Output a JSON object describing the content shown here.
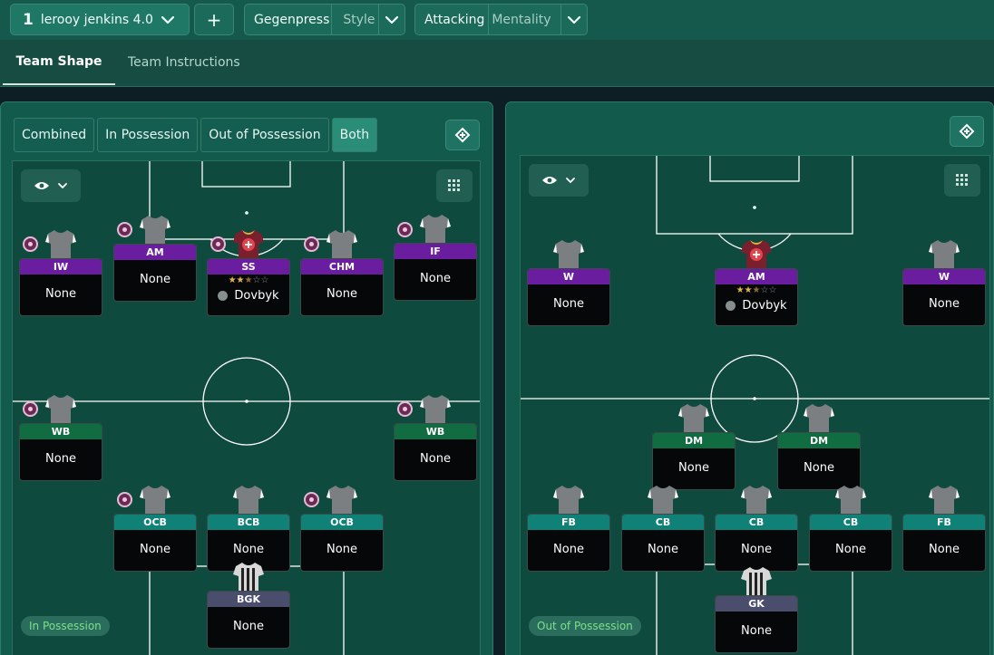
{
  "topbar": {
    "tactic_number": "1",
    "tactic_name": "lerooy jenkins 4.0",
    "add_label": "+",
    "style_value": "Gegenpress",
    "style_label": "Style",
    "mentality_value": "Attacking",
    "mentality_label": "Mentality"
  },
  "tabs": [
    {
      "label": "Team Shape",
      "active": true
    },
    {
      "label": "Team Instructions",
      "active": false
    }
  ],
  "view_modes": [
    "Combined",
    "In Possession",
    "Out of Possession",
    "Both"
  ],
  "active_view_mode": "Both",
  "colors": {
    "attack_role": "#6a1d9e",
    "midfield_role": "#126c42",
    "defence_role": "#0f8177",
    "goalkeeper_role": "#4a4d6c",
    "pill_text": "#7de08a"
  },
  "in_possession": {
    "label": "In Possession",
    "players": [
      {
        "role": "IW",
        "name": "None"
      },
      {
        "role": "AM",
        "name": "None"
      },
      {
        "role": "SS",
        "name": "Dovbyk",
        "stars": 2.5
      },
      {
        "role": "CHM",
        "name": "None"
      },
      {
        "role": "IF",
        "name": "None"
      },
      {
        "role": "WB",
        "name": "None"
      },
      {
        "role": "WB",
        "name": "None"
      },
      {
        "role": "OCB",
        "name": "None"
      },
      {
        "role": "BCB",
        "name": "None"
      },
      {
        "role": "OCB",
        "name": "None"
      },
      {
        "role": "BGK",
        "name": "None"
      }
    ]
  },
  "out_of_possession": {
    "label": "Out of Possession",
    "players": [
      {
        "role": "W",
        "name": "None"
      },
      {
        "role": "AM",
        "name": "Dovbyk",
        "stars": 2.5
      },
      {
        "role": "W",
        "name": "None"
      },
      {
        "role": "DM",
        "name": "None"
      },
      {
        "role": "DM",
        "name": "None"
      },
      {
        "role": "FB",
        "name": "None"
      },
      {
        "role": "CB",
        "name": "None"
      },
      {
        "role": "CB",
        "name": "None"
      },
      {
        "role": "CB",
        "name": "None"
      },
      {
        "role": "FB",
        "name": "None"
      },
      {
        "role": "GK",
        "name": "None"
      }
    ]
  },
  "icons": {
    "tactic_dropdown": "chevron-down-icon",
    "view": "eye-icon",
    "layout": "grid-icon",
    "swap": "swap-icon",
    "shirt": "shirt-icon",
    "role_instruction": "role-badge-icon"
  }
}
